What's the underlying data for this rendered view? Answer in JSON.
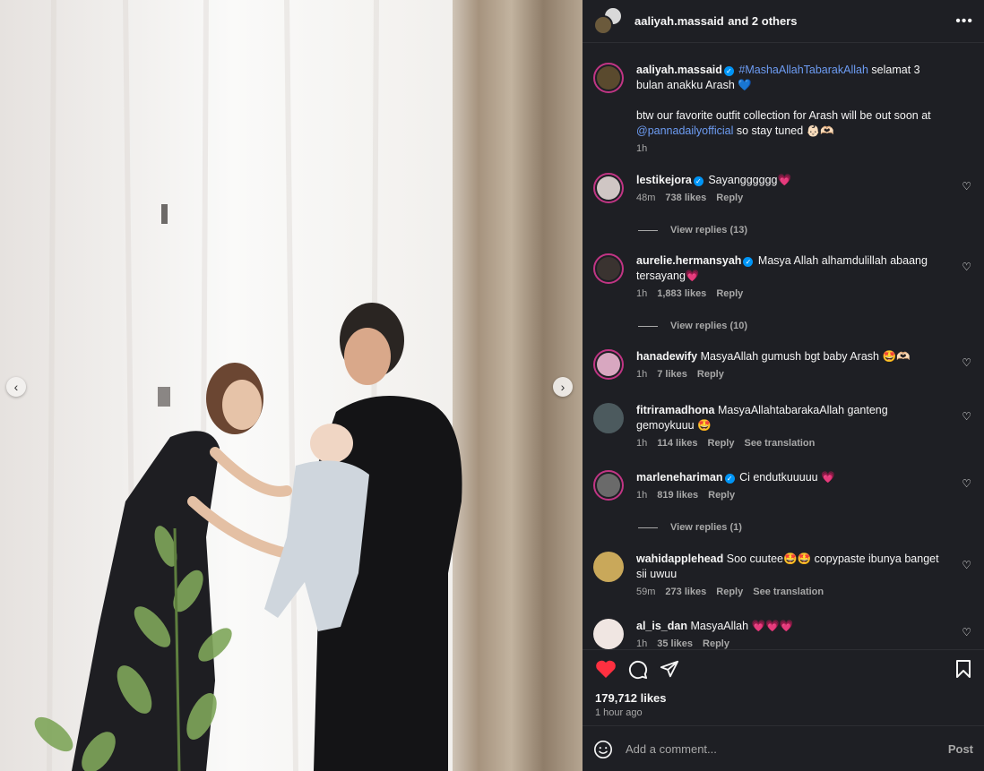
{
  "post": {
    "author": "aaliyah.massaid",
    "others": "and 2 others",
    "likes": "179,712 likes",
    "time": "1 hour ago"
  },
  "icons": {
    "more": "more-horizontal-icon",
    "like": "heart-filled-icon",
    "comment": "comment-icon",
    "share": "send-icon",
    "save": "bookmark-icon",
    "emoji": "emoji-icon",
    "prev": "chevron-left-icon",
    "next": "chevron-right-icon"
  },
  "colors": {
    "accent": "#0095f6",
    "like": "#ff3040",
    "hashtag": "#6d9cf3",
    "panel": "#1e1f24"
  },
  "caption": {
    "username": "aaliyah.massaid",
    "hashtag": "#MashaAllahTabarakAllah",
    "text1": "selamat 3 bulan anakku Arash 💙",
    "text2_pre": "btw our favorite outfit collection for Arash will be out soon at",
    "mention": "@pannadailyofficial",
    "text2_post": "so stay tuned 👶🏻🫶🏻",
    "time": "1h"
  },
  "comments": [
    {
      "username": "lestikejora",
      "verified": true,
      "text": "Sayangggggg💗",
      "time": "48m",
      "likes": "738 likes",
      "reply": "Reply",
      "view_replies": "View replies (13)"
    },
    {
      "username": "aurelie.hermansyah",
      "verified": true,
      "text": "Masya Allah alhamdulillah abaang tersayang💗",
      "time": "1h",
      "likes": "1,883 likes",
      "reply": "Reply",
      "view_replies": "View replies (10)"
    },
    {
      "username": "hanadewify",
      "verified": false,
      "text": "MasyaAllah gumush bgt baby Arash 🤩🫶🏻",
      "time": "1h",
      "likes": "7 likes",
      "reply": "Reply"
    },
    {
      "username": "fitriramadhona",
      "verified": false,
      "text": "MasyaAllahtabarakaAllah ganteng gemoykuuu 🤩",
      "time": "1h",
      "likes": "114 likes",
      "reply": "Reply",
      "translate": "See translation"
    },
    {
      "username": "marlenehariman",
      "verified": true,
      "text": "Ci endutkuuuuu 💗",
      "time": "1h",
      "likes": "819 likes",
      "reply": "Reply",
      "view_replies": "View replies (1)"
    },
    {
      "username": "wahidapplehead",
      "verified": false,
      "text": "Soo cuutee🤩🤩 copypaste ibunya banget sii uwuu",
      "time": "59m",
      "likes": "273 likes",
      "reply": "Reply",
      "translate": "See translation"
    },
    {
      "username": "al_is_dan",
      "verified": false,
      "text": "MasyaAllah 💗💗💗",
      "time": "1h",
      "likes": "35 likes",
      "reply": "Reply"
    }
  ],
  "add_comment": {
    "placeholder": "Add a comment...",
    "post_label": "Post"
  }
}
